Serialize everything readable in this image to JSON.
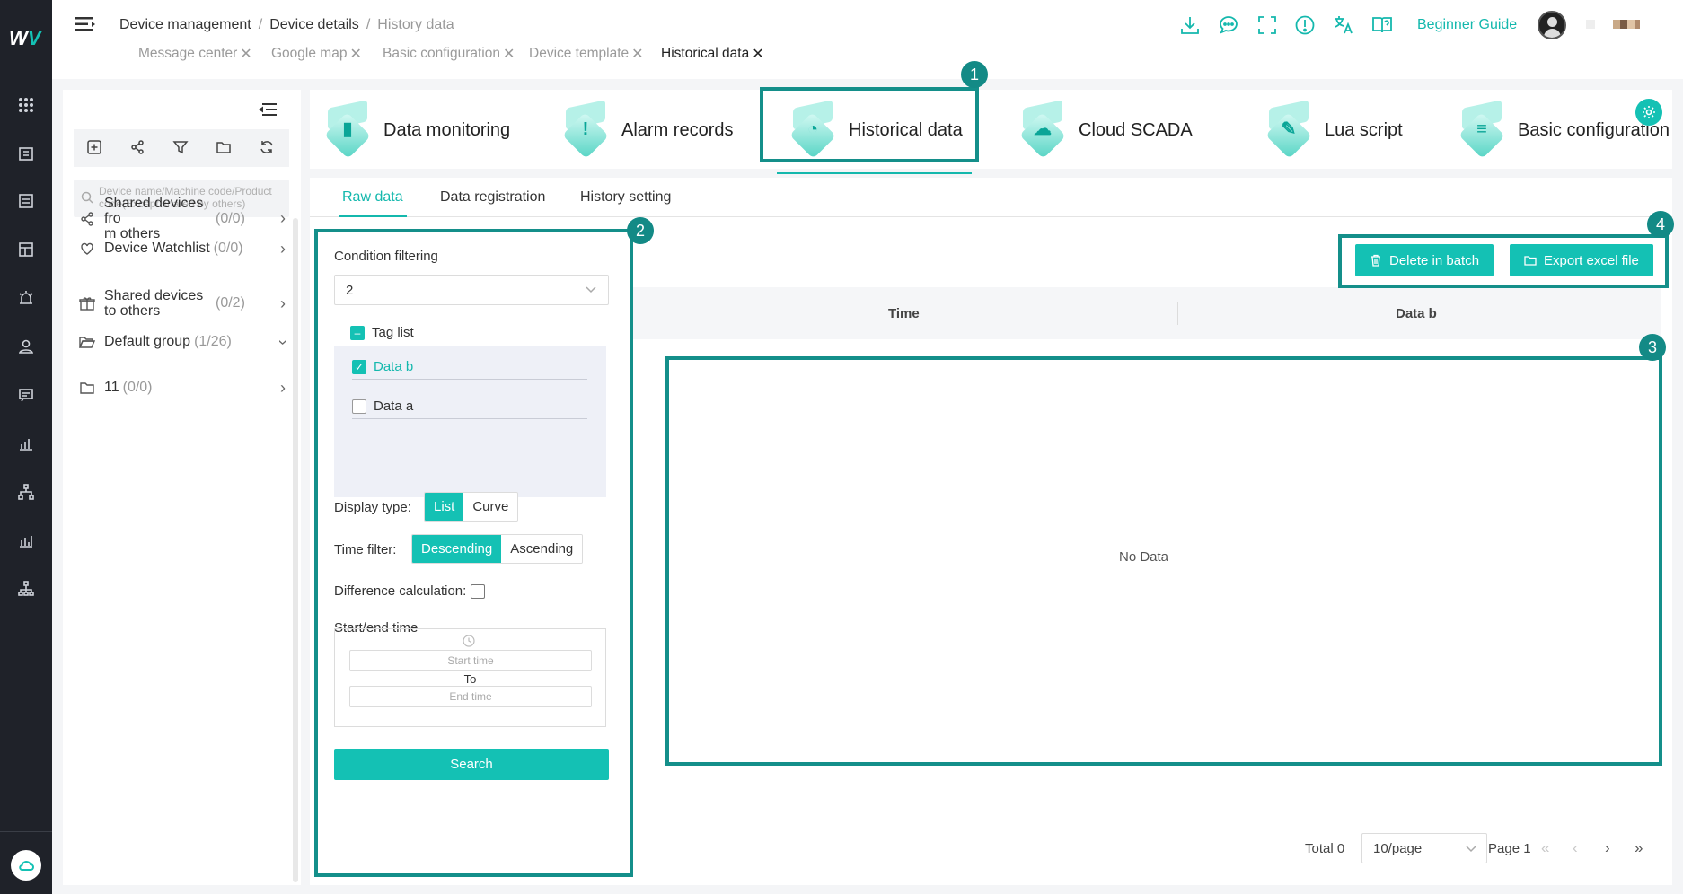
{
  "header": {
    "breadcrumb": [
      "Device management",
      "Device details",
      "History data"
    ],
    "tabs": [
      "Message center",
      "Google map",
      "Basic configuration",
      "Device template",
      "Historical data"
    ],
    "active_tab": "Historical data",
    "guide_label": "Beginner Guide",
    "icons": [
      "download-icon",
      "chat-icon",
      "fullscreen-icon",
      "alert-icon",
      "translate-icon",
      "help-book-icon"
    ]
  },
  "tree": {
    "search_placeholder": "Device name/Machine code/Product code(Except shared by others)",
    "items": [
      {
        "label": "Shared devices fro\nm others",
        "count": "(0/0)"
      },
      {
        "label": "Device Watchlist",
        "count": "(0/0)"
      },
      {
        "label": "Shared devices to others",
        "count": "(0/2)"
      },
      {
        "label": "Default group",
        "count": "(1/26)"
      },
      {
        "label": "11",
        "count": "(0/0)"
      }
    ]
  },
  "functions": [
    {
      "label": "Data monitoring"
    },
    {
      "label": "Alarm records"
    },
    {
      "label": "Historical data"
    },
    {
      "label": "Cloud SCADA"
    },
    {
      "label": "Lua script"
    },
    {
      "label": "Basic configuration"
    }
  ],
  "subtabs": [
    "Raw data",
    "Data registration",
    "History setting"
  ],
  "filter": {
    "condition_label": "Condition filtering",
    "condition_value": "2",
    "tag_list_label": "Tag list",
    "tags": [
      {
        "label": "Data b",
        "checked": true
      },
      {
        "label": "Data a",
        "checked": false
      }
    ],
    "display_type_label": "Display type:",
    "display_options": [
      "List",
      "Curve"
    ],
    "display_selected": "List",
    "time_filter_label": "Time filter:",
    "time_options": [
      "Descending",
      "Ascending"
    ],
    "time_selected": "Descending",
    "difference_label": "Difference calculation:",
    "difference_checked": false,
    "start_end_label": "Start/end time",
    "start_placeholder": "Start time",
    "to_label": "To",
    "end_placeholder": "End time",
    "search_label": "Search"
  },
  "actions": {
    "delete_label": "Delete in batch",
    "export_label": "Export excel file"
  },
  "table": {
    "columns": [
      "Time",
      "Data b"
    ],
    "rows": [],
    "empty_text": "No Data"
  },
  "pagination": {
    "total": "Total 0",
    "page_size": "10/page",
    "page": "Page 1"
  },
  "annotations": [
    "1",
    "2",
    "3",
    "4"
  ],
  "colors": {
    "accent": "#14c1b4",
    "annotation": "#148f8a",
    "rail": "#1f2229"
  }
}
